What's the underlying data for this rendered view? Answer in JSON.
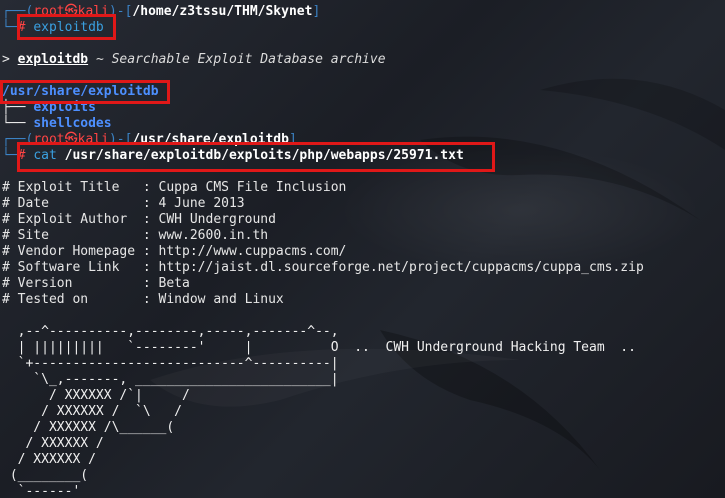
{
  "prompt1": {
    "user_host": "root㉿kali",
    "path": "/home/z3tssu/THM/Skynet",
    "command": "exploitdb"
  },
  "exploitdb_desc": {
    "name": "exploitdb",
    "tilde": "~",
    "desc": "Searchable Exploit Database archive"
  },
  "tree": {
    "root": "/usr/share/exploitdb",
    "items": [
      "exploits",
      "shellcodes"
    ]
  },
  "prompt2": {
    "user_host": "root㉿kali",
    "path": "/usr/share/exploitdb",
    "command": "cat",
    "arg": "/usr/share/exploitdb/exploits/php/webapps/25971.txt"
  },
  "file_header": [
    "# Exploit Title   : Cuppa CMS File Inclusion",
    "# Date            : 4 June 2013",
    "# Exploit Author  : CWH Underground",
    "# Site            : www.2600.in.th",
    "# Vendor Homepage : http://www.cuppacms.com/",
    "# Software Link   : http://jaist.dl.sourceforge.net/project/cuppacms/cuppa_cms.zip",
    "# Version         : Beta",
    "# Tested on       : Window and Linux"
  ],
  "ascii_art": [
    "  ,--^----------,--------,-----,-------^--,",
    "  | |||||||||   `--------'     |          O  ..  CWH Underground Hacking Team  ..",
    "  `+---------------------------^----------|",
    "    `\\_,-------, _________________________|",
    "      / XXXXXX /`|     /",
    "     / XXXXXX /  `\\   /",
    "    / XXXXXX /\\______(",
    "   / XXXXXX /",
    "  / XXXXXX /",
    " (________(",
    "  `------'"
  ]
}
